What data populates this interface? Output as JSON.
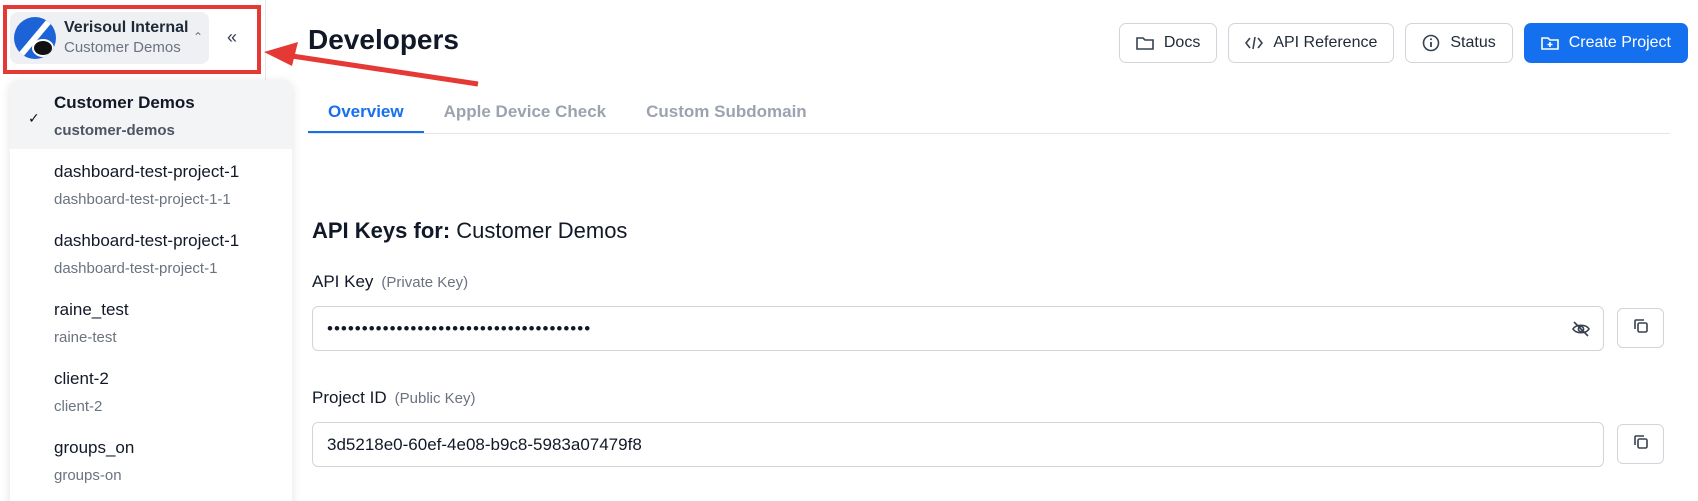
{
  "sidebar": {
    "org": {
      "name": "Verisoul Internal",
      "project": "Customer Demos"
    },
    "collapse_icon": "«",
    "projects": [
      {
        "title": "Customer Demos",
        "slug": "customer-demos",
        "selected": true
      },
      {
        "title": "dashboard-test-project-1",
        "slug": "dashboard-test-project-1-1"
      },
      {
        "title": "dashboard-test-project-1",
        "slug": "dashboard-test-project-1"
      },
      {
        "title": "raine_test",
        "slug": "raine-test"
      },
      {
        "title": "client-2",
        "slug": "client-2"
      },
      {
        "title": "groups_on",
        "slug": "groups-on"
      }
    ]
  },
  "header": {
    "title": "Developers",
    "buttons": {
      "docs": "Docs",
      "api_reference": "API Reference",
      "status": "Status",
      "create_project": "Create Project"
    }
  },
  "tabs": [
    "Overview",
    "Apple Device Check",
    "Custom Subdomain"
  ],
  "api_keys": {
    "heading_bold": "API Keys for:",
    "heading_project": "Customer Demos",
    "api_key": {
      "label": "API Key",
      "hint": "(Private Key)",
      "value": "••••••••••••••••••••••••••••••••••••••"
    },
    "project_id": {
      "label": "Project ID",
      "hint": "(Public Key)",
      "value": "3d5218e0-60ef-4e08-b9c8-5983a07479f8"
    }
  },
  "colors": {
    "accent": "#1570ef",
    "highlight": "#e53935"
  }
}
